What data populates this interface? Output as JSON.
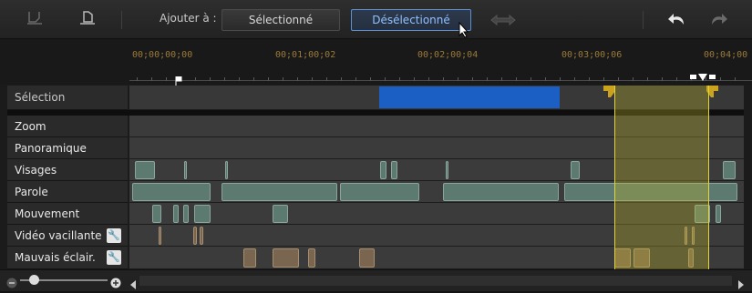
{
  "toolbar": {
    "add_label": "Ajouter à :",
    "select_button": "Sélectionné",
    "deselect_button": "Désélectionné",
    "icons": [
      "mark-in-icon",
      "mark-out-icon",
      "swap-arrows-icon",
      "undo-icon",
      "redo-icon"
    ]
  },
  "ruler": {
    "timecodes": [
      "00;00;00;00",
      "00;01;00;02",
      "00;02;00;04",
      "00;03;00;06",
      "00;04;00"
    ]
  },
  "tracks": {
    "selection": "Sélection",
    "zoom": "Zoom",
    "pan": "Panoramique",
    "faces": "Visages",
    "speech": "Parole",
    "motion": "Mouvement",
    "shaky": "Vidéo vacillante",
    "low_light": "Mauvais éclair."
  },
  "colors": {
    "selection_bar": "#1b5fc4",
    "highlight": "#c8bc2a",
    "clip_green": "#5c7a70",
    "clip_brown": "#7a6550"
  }
}
